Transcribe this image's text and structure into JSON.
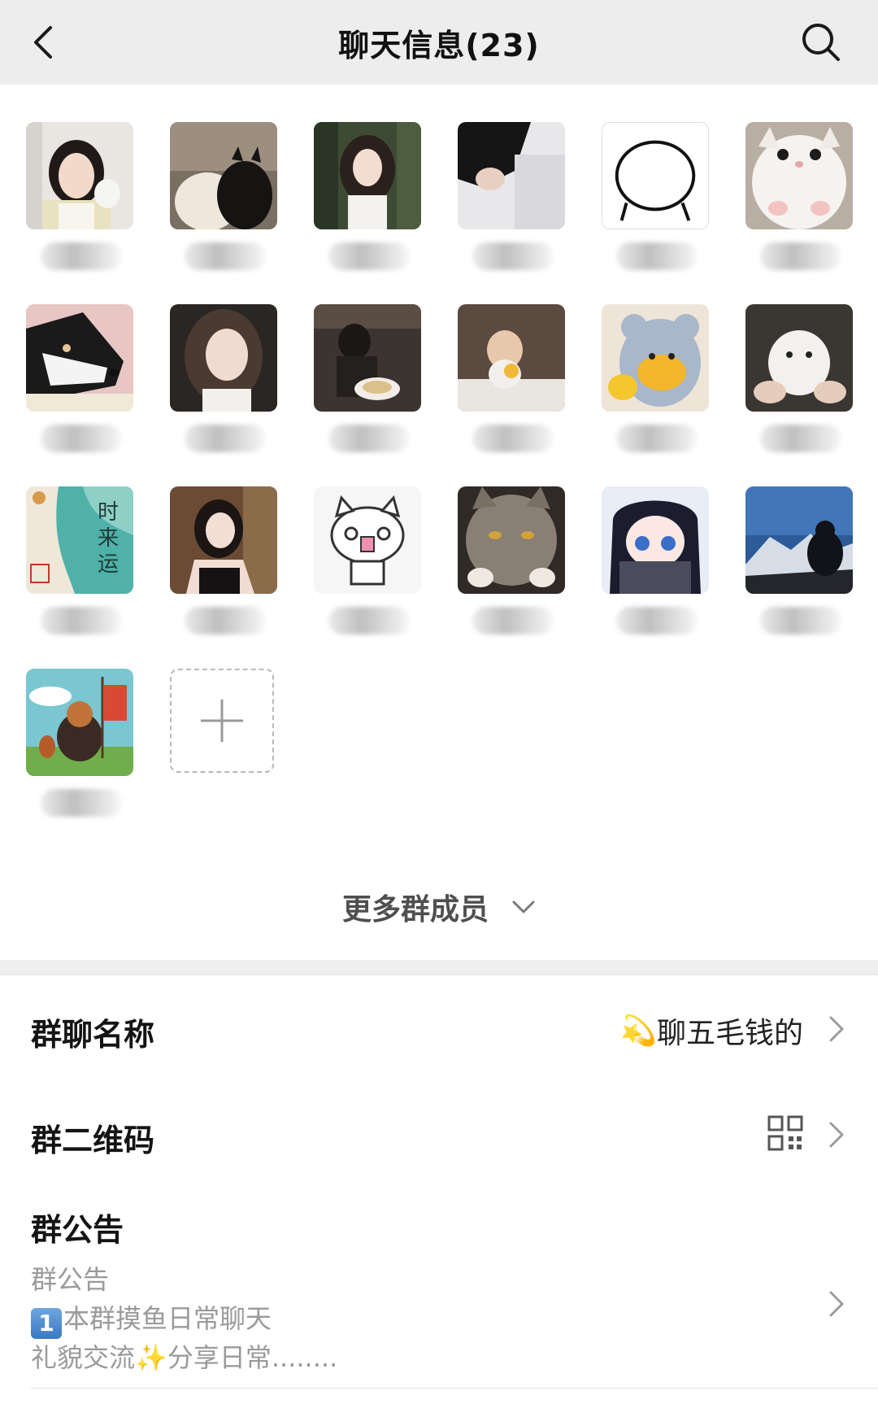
{
  "header": {
    "title": "聊天信息(23)",
    "back_icon": "back-arrow-icon",
    "search_icon": "search-icon",
    "background": "#ededed"
  },
  "members": [
    {
      "name": "",
      "avatar": "girl-portrait"
    },
    {
      "name": "",
      "avatar": "two-cats"
    },
    {
      "name": "",
      "avatar": "girl-forest"
    },
    {
      "name": "",
      "avatar": "dark-hair-person"
    },
    {
      "name": "",
      "avatar": "sketch-face"
    },
    {
      "name": "",
      "avatar": "white-kitten"
    },
    {
      "name": "",
      "avatar": "husky-dog"
    },
    {
      "name": "",
      "avatar": "girl-selfie"
    },
    {
      "name": "",
      "avatar": "boy-dinner"
    },
    {
      "name": "",
      "avatar": "baby-eating"
    },
    {
      "name": "",
      "avatar": "bear-costume-duck"
    },
    {
      "name": "",
      "avatar": "white-puppy"
    },
    {
      "name": "",
      "avatar": "chinese-calligraphy"
    },
    {
      "name": "",
      "avatar": "girl-dark-room"
    },
    {
      "name": "",
      "avatar": "cartoon-cat"
    },
    {
      "name": "",
      "avatar": "grey-cat"
    },
    {
      "name": "",
      "avatar": "anime-girl-scarf"
    },
    {
      "name": "",
      "avatar": "mountain-silhouette"
    },
    {
      "name": "",
      "avatar": "cartoon-journey"
    }
  ],
  "add_member_icon": "plus-icon",
  "more_members": {
    "label": "更多群成员",
    "icon": "chevron-down-icon"
  },
  "settings": {
    "group_name": {
      "label": "群聊名称",
      "value": "聊五毛钱的",
      "emoji": "💫"
    },
    "qr_code": {
      "label": "群二维码",
      "icon": "qr-code-icon"
    },
    "announcement": {
      "label": "群公告",
      "sub_label": "群公告",
      "line1_key": "1",
      "line1": "本群摸鱼日常聊天",
      "line2_a": "礼貌交流",
      "line2_sparkle": "✨",
      "line2_b": "分享日常........"
    }
  }
}
